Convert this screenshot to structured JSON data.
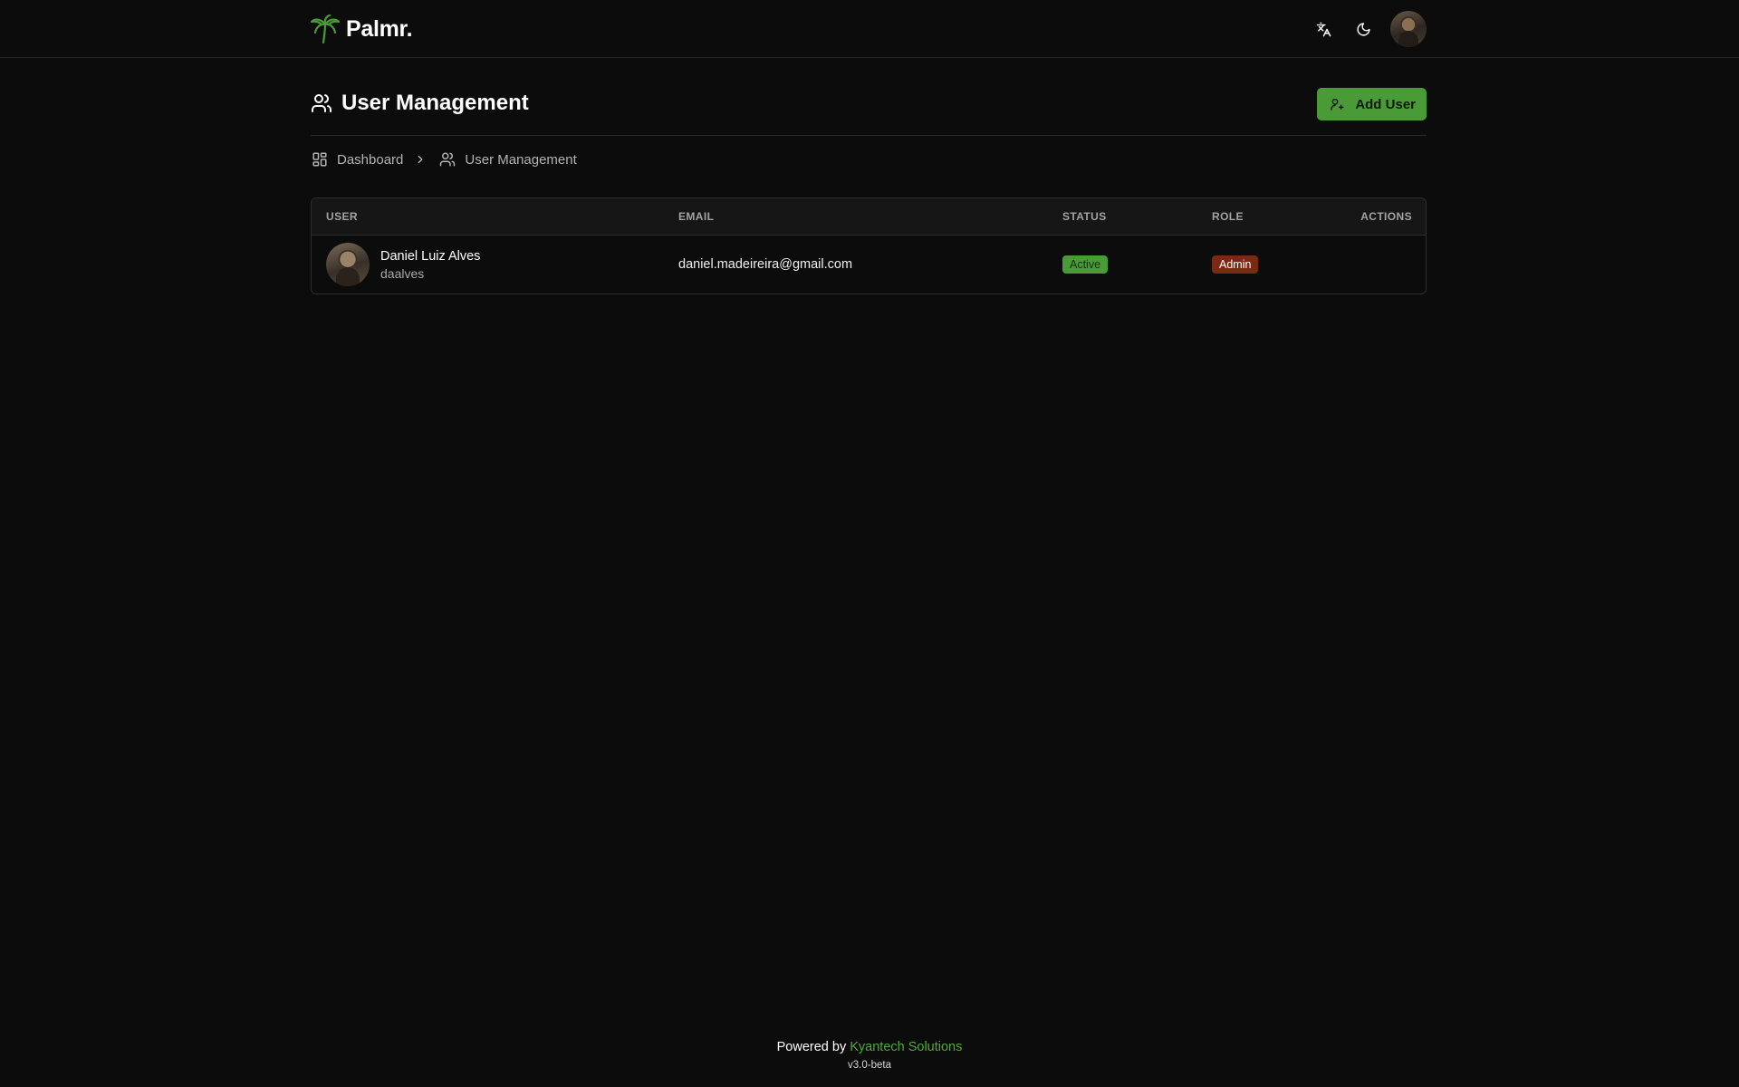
{
  "app": {
    "name": "Palmr.",
    "accent_color": "#4a9a38"
  },
  "header": {
    "actions": [
      {
        "name": "language-icon"
      },
      {
        "name": "moon-icon"
      },
      {
        "name": "user-avatar"
      }
    ]
  },
  "page": {
    "title": "User Management",
    "add_button_label": "Add User"
  },
  "breadcrumb": {
    "items": [
      "Dashboard",
      "User Management"
    ]
  },
  "table": {
    "columns": [
      "USER",
      "EMAIL",
      "STATUS",
      "ROLE",
      "ACTIONS"
    ],
    "rows": [
      {
        "name": "Daniel Luiz Alves",
        "username": "daalves",
        "email": "daniel.madeireira@gmail.com",
        "status": "Active",
        "status_color": "#4a9a38",
        "role": "Admin",
        "role_color": "#7a2a12"
      }
    ]
  },
  "footer": {
    "powered_by": "Powered by",
    "company": "Kyantech Solutions",
    "version": "v3.0-beta"
  }
}
